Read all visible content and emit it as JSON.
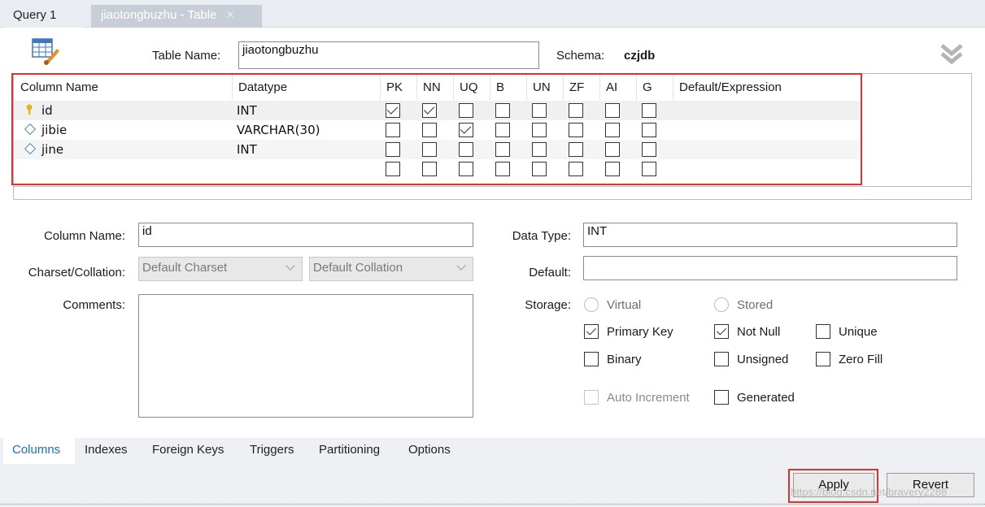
{
  "tabs": {
    "query_label": "Query 1",
    "table_label": "jiaotongbuzhu - Table",
    "close_glyph": "×"
  },
  "header": {
    "table_name_label": "Table Name:",
    "table_name_value": "jiaotongbuzhu",
    "schema_label": "Schema:",
    "schema_value": "czjdb"
  },
  "grid": {
    "headers": {
      "column_name": "Column Name",
      "datatype": "Datatype",
      "pk": "PK",
      "nn": "NN",
      "uq": "UQ",
      "b": "B",
      "un": "UN",
      "zf": "ZF",
      "ai": "AI",
      "g": "G",
      "default": "Default/Expression"
    },
    "rows": [
      {
        "name": "id",
        "type": "INT",
        "icon": "primary-key-icon",
        "flags": [
          true,
          true,
          false,
          false,
          false,
          false,
          false,
          false
        ]
      },
      {
        "name": "jibie",
        "type": "VARCHAR(30)",
        "icon": "column-diamond-icon",
        "flags": [
          false,
          false,
          true,
          false,
          false,
          false,
          false,
          false
        ]
      },
      {
        "name": "jine",
        "type": "INT",
        "icon": "column-diamond-icon",
        "flags": [
          false,
          false,
          false,
          false,
          false,
          false,
          false,
          false
        ]
      },
      {
        "name": "",
        "type": "",
        "icon": "",
        "flags": [
          false,
          false,
          false,
          false,
          false,
          false,
          false,
          false
        ]
      }
    ]
  },
  "details": {
    "column_name_label": "Column Name:",
    "column_name_value": "id",
    "charset_label": "Charset/Collation:",
    "charset_value": "Default Charset",
    "collation_value": "Default Collation",
    "comments_label": "Comments:",
    "data_type_label": "Data Type:",
    "data_type_value": "INT",
    "default_label": "Default:",
    "default_value": "",
    "storage_label": "Storage:",
    "virtual_label": "Virtual",
    "stored_label": "Stored",
    "primary_key_label": "Primary Key",
    "not_null_label": "Not Null",
    "unique_label": "Unique",
    "binary_label": "Binary",
    "unsigned_label": "Unsigned",
    "zero_fill_label": "Zero Fill",
    "auto_increment_label": "Auto Increment",
    "generated_label": "Generated"
  },
  "bottom_tabs": [
    "Columns",
    "Indexes",
    "Foreign Keys",
    "Triggers",
    "Partitioning",
    "Options"
  ],
  "footer": {
    "apply_label": "Apply",
    "revert_label": "Revert",
    "watermark": "https://blog.csdn.net/bravery2288"
  },
  "colors": {
    "highlight_red": "#e0312f",
    "active_tab_blue": "#1b6fc2",
    "diamond_blue": "#4a8ac8",
    "key_yellow": "#e8b21c"
  }
}
